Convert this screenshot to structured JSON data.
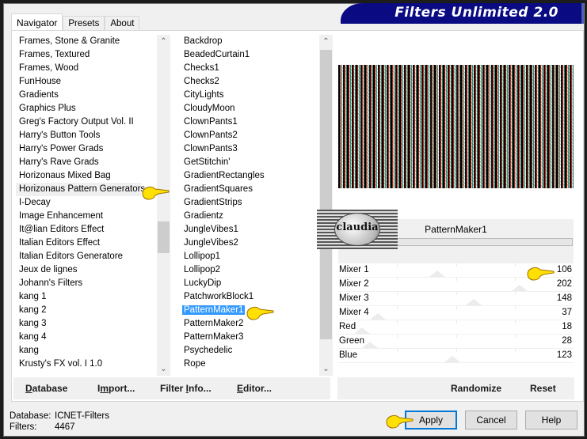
{
  "window": {
    "banner_title": "Filters Unlimited 2.0"
  },
  "tabs": [
    {
      "label": "Navigator",
      "active": true
    },
    {
      "label": "Presets",
      "active": false
    },
    {
      "label": "About",
      "active": false
    }
  ],
  "categories": {
    "items": [
      "Frames, Stone & Granite",
      "Frames, Textured",
      "Frames, Wood",
      "FunHouse",
      "Gradients",
      "Graphics Plus",
      "Greg's Factory Output Vol. II",
      "Harry's Button Tools",
      "Harry's Power Grads",
      "Harry's Rave Grads",
      "Horizonaus Mixed Bag",
      "Horizonaus Pattern Generators",
      "I-Decay",
      "Image Enhancement",
      "It@lian Editors Effect",
      "Italian Editors Effect",
      "Italian Editors Generatore",
      "Jeux de lignes",
      "Johann's Filters",
      "kang 1",
      "kang 2",
      "kang 3",
      "kang 4",
      "kang",
      "Krusty's FX vol. I 1.0"
    ],
    "highlighted": "Horizonaus Pattern Generators"
  },
  "filters": {
    "items": [
      "Backdrop",
      "BeadedCurtain1",
      "Checks1",
      "Checks2",
      "CityLights",
      "CloudyMoon",
      "ClownPants1",
      "ClownPants2",
      "ClownPants3",
      "GetStitchin'",
      "GradientRectangles",
      "GradientSquares",
      "GradientStrips",
      "Gradientz",
      "JungleVibes1",
      "JungleVibes2",
      "Lollipop1",
      "Lollipop2",
      "LuckyDip",
      "PatchworkBlock1",
      "PatternMaker1",
      "PatternMaker2",
      "PatternMaker3",
      "Psychedelic",
      "Rope"
    ],
    "selected": "PatternMaker1"
  },
  "left_buttons": {
    "database": "Database",
    "import": "Import...",
    "filter_info": "Filter Info...",
    "editor": "Editor..."
  },
  "preview": {
    "filter_name": "PatternMaker1",
    "watermark_text": "claudia"
  },
  "sliders": [
    {
      "name": "Mixer 1",
      "value": 106
    },
    {
      "name": "Mixer  2",
      "value": 202
    },
    {
      "name": "Mixer  3",
      "value": 148
    },
    {
      "name": "Mixer  4",
      "value": 37
    },
    {
      "name": "Red",
      "value": 18
    },
    {
      "name": "Green",
      "value": 28
    },
    {
      "name": "Blue",
      "value": 123
    }
  ],
  "slider_max": 255,
  "right_buttons": {
    "randomize": "Randomize",
    "reset": "Reset"
  },
  "status": {
    "database_label": "Database:",
    "database_value": "ICNET-Filters",
    "filters_label": "Filters:",
    "filters_value": "4467"
  },
  "dialog_buttons": {
    "apply": "Apply",
    "cancel": "Cancel",
    "help": "Help"
  },
  "colors": {
    "banner": "#0a0a82",
    "selection": "#3399ff",
    "default_button_border": "#0078d7"
  }
}
